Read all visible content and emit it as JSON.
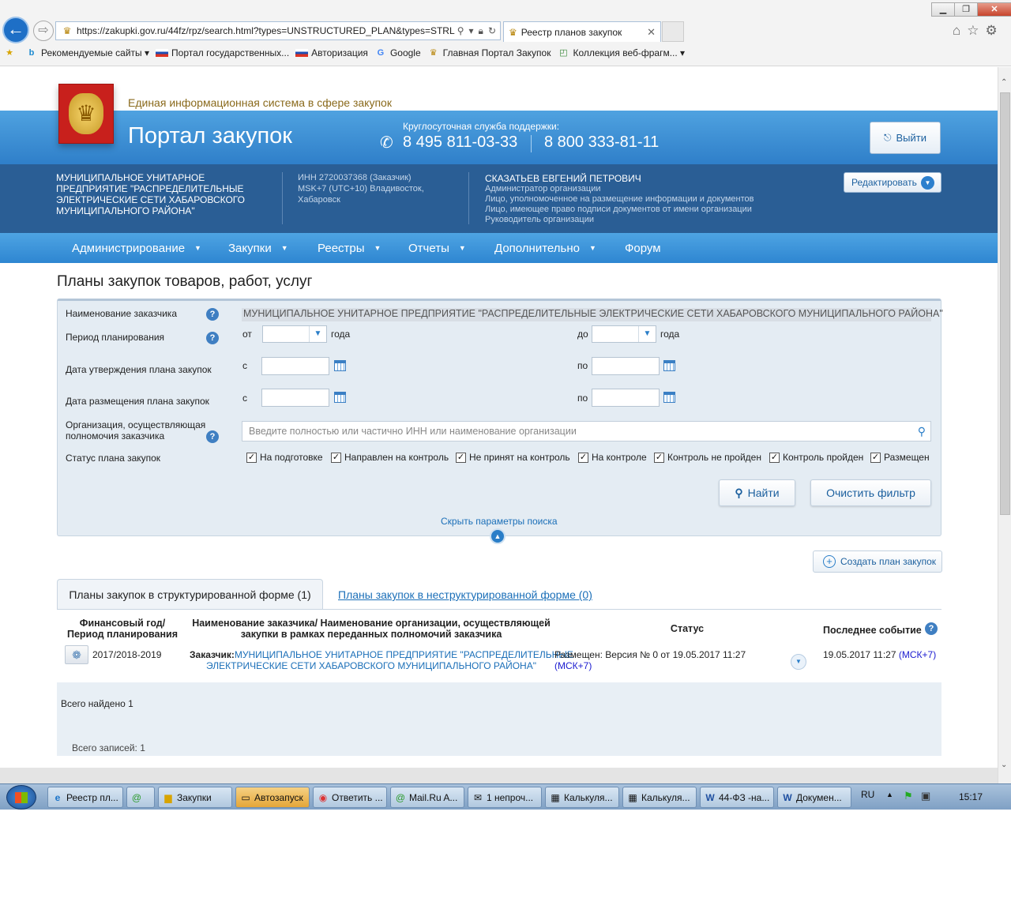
{
  "browser": {
    "back_icon": "←",
    "forward_icon": "⇨",
    "url": "https://zakupki.gov.ru/44fz/rpz/search.html?types=UNSTRUCTURED_PLAN&types=STRL",
    "tab_title": "Реестр планов закупок",
    "window_buttons": {
      "minimize": "▁",
      "maximize": "❐",
      "close": "✕"
    },
    "favorites": [
      {
        "label": "Рекомендуемые сайты ▾",
        "icon": "bing-icon"
      },
      {
        "label": "Портал государственных...",
        "icon": "russian-flag-icon"
      },
      {
        "label": "Авторизация",
        "icon": "russian-flag-icon"
      },
      {
        "label": "Google",
        "icon": "google-icon"
      },
      {
        "label": "Главная Портал Закупок",
        "icon": "emblem-icon"
      },
      {
        "label": "Коллекция веб-фрагм... ▾",
        "icon": "web-slice-icon"
      }
    ]
  },
  "header": {
    "slogan": "Единая информационная система в сфере закупок",
    "portal_title": "Портал закупок",
    "support_label": "Круглосуточная служба поддержки:",
    "phone1": "8 495 811-03-33",
    "phone2": "8 800 333-81-11",
    "logout_label": "Выйти"
  },
  "org": {
    "name": "МУНИЦИПАЛЬНОЕ УНИТАРНОЕ ПРЕДПРИЯТИЕ \"РАСПРЕДЕЛИТЕЛЬНЫЕ ЭЛЕКТРИЧЕСКИЕ СЕТИ ХАБАРОВСКОГО МУНИЦИПАЛЬНОГО РАЙОНА\"",
    "inn": "ИНН 2720037368 (Заказчик)",
    "timezone": "MSK+7 (UTC+10) Владивосток, Хабаровск",
    "user_name": "СКАЗАТЬЕВ ЕВГЕНИЙ ПЕТРОВИЧ",
    "roles": [
      "Администратор организации",
      "Лицо, уполномоченное на размещение информации и документов",
      "Лицо, имеющее право подписи документов от имени организации",
      "Руководитель организации"
    ],
    "edit_label": "Редактировать"
  },
  "nav": [
    {
      "label": "Администрирование",
      "caret": true
    },
    {
      "label": "Закупки",
      "caret": true
    },
    {
      "label": "Реестры",
      "caret": true
    },
    {
      "label": "Отчеты",
      "caret": true
    },
    {
      "label": "Дополнительно",
      "caret": true
    },
    {
      "label": "Форум",
      "caret": false
    }
  ],
  "page_title": "Планы закупок товаров, работ, услуг",
  "filter": {
    "customer_label": "Наименование заказчика",
    "customer_value": "МУНИЦИПАЛЬНОЕ УНИТАРНОЕ ПРЕДПРИЯТИЕ \"РАСПРЕДЕЛИТЕЛЬНЫЕ ЭЛЕКТРИЧЕСКИЕ СЕТИ ХАБАРОВСКОГО МУНИЦИПАЛЬНОГО РАЙОНА\"",
    "period_label": "Период планирования",
    "from": "от",
    "to": "до",
    "year": "года",
    "approval_label": "Дата утверждения плана закупок",
    "placement_label": "Дата размещения плана закупок",
    "since": "с",
    "until": "по",
    "org_label": "Организация, осуществляющая полномочия заказчика",
    "org_placeholder": "Введите полностью или частично ИНН или наименование организации",
    "status_label": "Статус плана закупок",
    "statuses": [
      {
        "label": "На подготовке",
        "checked": true
      },
      {
        "label": "Направлен на контроль",
        "checked": true
      },
      {
        "label": "Не принят на контроль",
        "checked": true
      },
      {
        "label": "На контроле",
        "checked": true
      },
      {
        "label": "Контроль не пройден",
        "checked": true
      },
      {
        "label": "Контроль пройден",
        "checked": true
      },
      {
        "label": "Размещен",
        "checked": true
      }
    ],
    "check_mark": "✓",
    "search_label": "Найти",
    "clear_label": "Очистить фильтр",
    "hide_label": "Скрыть параметры поиска"
  },
  "create_label": "Создать план закупок",
  "tabs": {
    "structured": "Планы закупок в структурированной форме (1)",
    "unstructured": "Планы закупок в неструктурированной форме (0)"
  },
  "table": {
    "headers": {
      "year": "Финансовый год/ Период планирования",
      "customer": "Наименование заказчика/ Наименование организации, осуществляющей закупки в рамках переданных полномочий заказчика",
      "status": "Статус",
      "event": "Последнее событие"
    },
    "rows": [
      {
        "year": "2017/2018-2019",
        "customer_prefix": "Заказчик:",
        "customer_line1": "МУНИЦИПАЛЬНОЕ УНИТАРНОЕ ПРЕДПРИЯТИЕ \"РАСПРЕДЕЛИТЕЛЬНЫЕ",
        "customer_line2": "ЭЛЕКТРИЧЕСКИЕ СЕТИ ХАБАРОВСКОГО МУНИЦИПАЛЬНОГО РАЙОНА\"",
        "status_line1": "Размещен: Версия № 0 от 19.05.2017 11:27",
        "status_line2": "(МСК+7)",
        "event_date": "19.05.2017 11:27",
        "event_tz": "(МСК+7)"
      }
    ],
    "total": "Всего найдено 1",
    "records": "Всего записей: 1"
  },
  "taskbar": {
    "items": [
      {
        "label": "Реестр пл...",
        "icon": "ie-icon",
        "active": false
      },
      {
        "label": "",
        "icon": "mailru-agent-icon",
        "active": false
      },
      {
        "label": "Закупки",
        "icon": "folder-icon",
        "active": false
      },
      {
        "label": "Автозапуск",
        "icon": "drive-icon",
        "active": true
      },
      {
        "label": "Ответить ...",
        "icon": "chrome-icon",
        "active": false
      },
      {
        "label": "Mail.Ru A...",
        "icon": "mailru-agent-icon",
        "active": false
      },
      {
        "label": "1 непроч...",
        "icon": "mail-icon",
        "active": false
      },
      {
        "label": "Калькуля...",
        "icon": "calculator-icon",
        "active": false
      },
      {
        "label": "Калькуля...",
        "icon": "calculator-icon",
        "active": false
      },
      {
        "label": "44-ФЗ -на...",
        "icon": "word-icon",
        "active": false
      },
      {
        "label": "Докумен...",
        "icon": "word-icon",
        "active": false
      }
    ],
    "lang": "RU",
    "clock": "15:17"
  }
}
